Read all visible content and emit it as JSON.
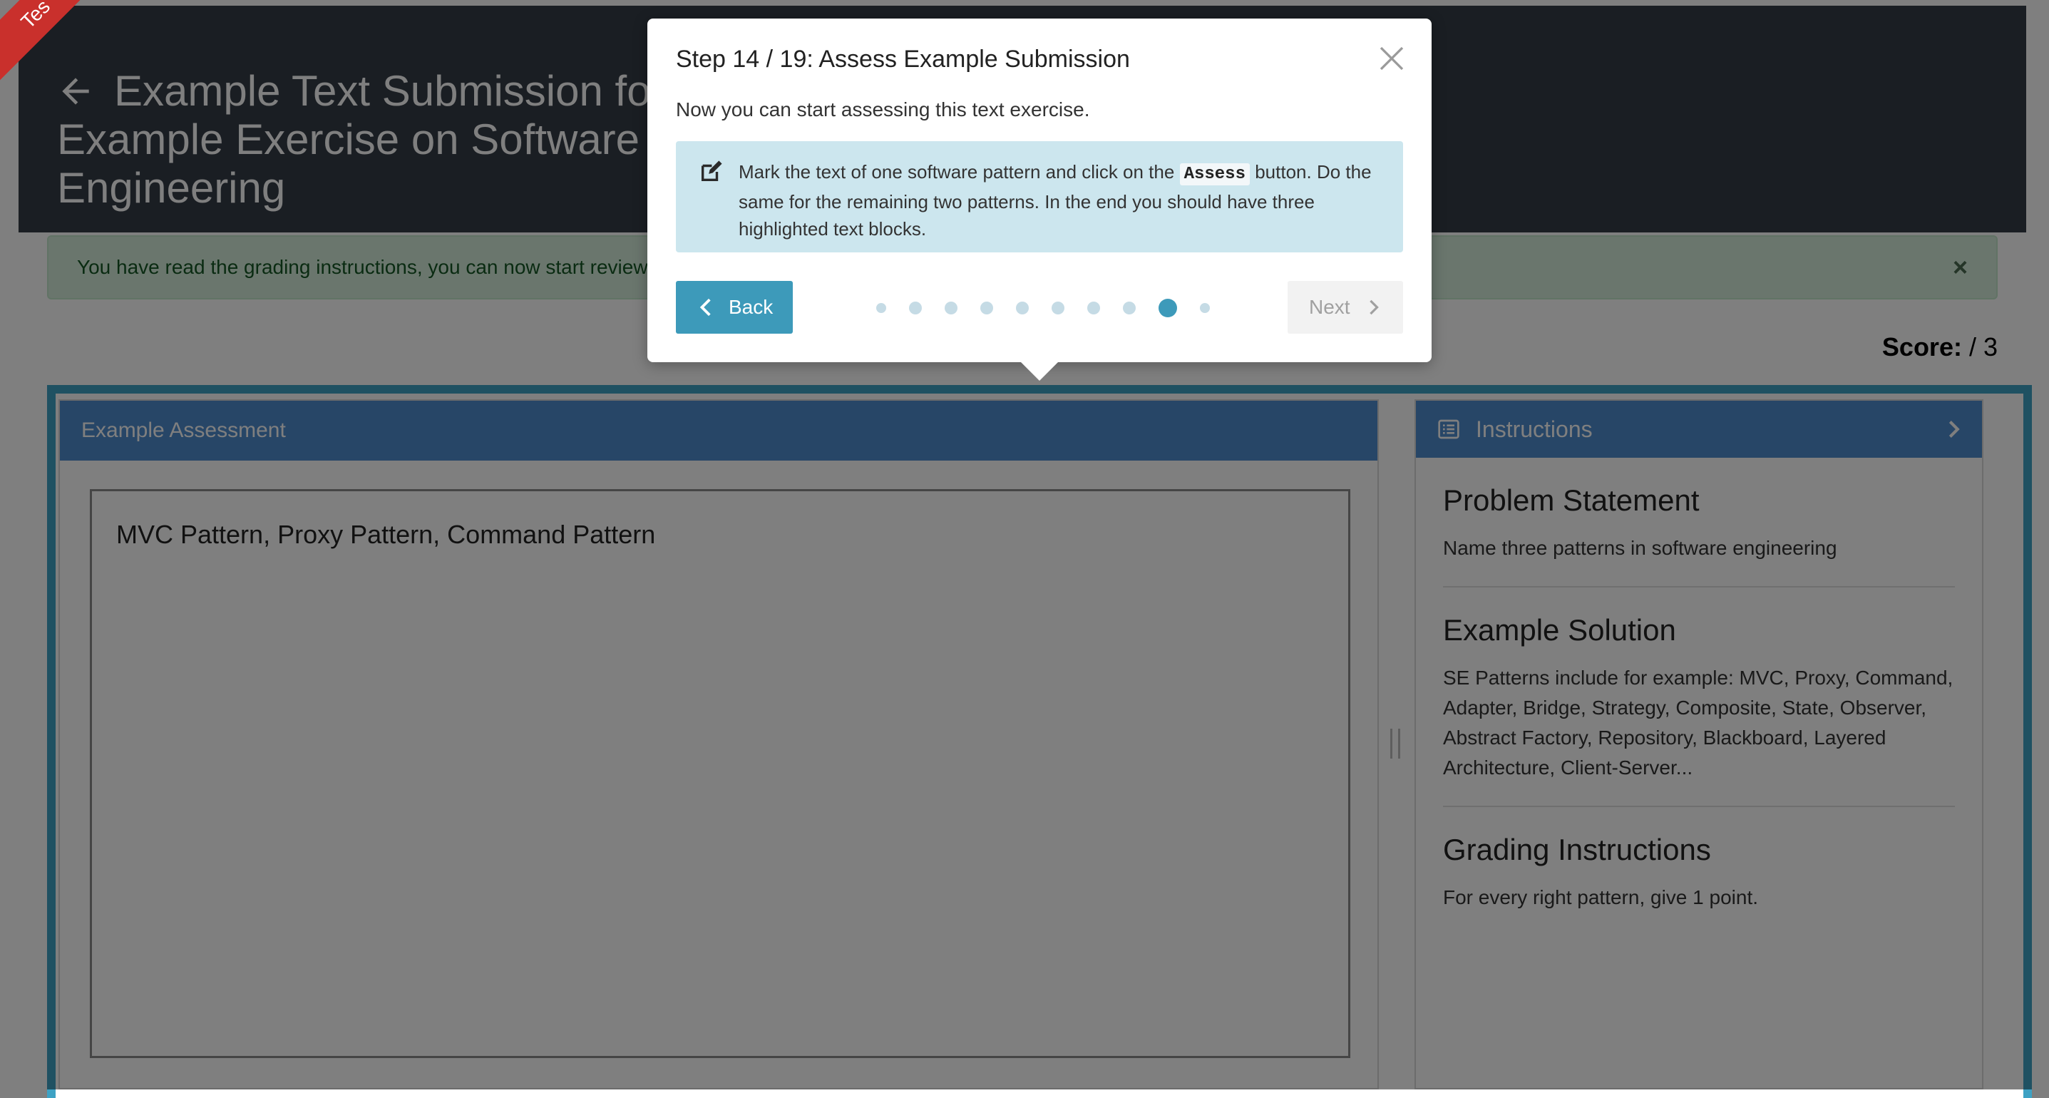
{
  "ribbon": {
    "label": "Tes"
  },
  "header": {
    "title": "Example Text Submission for Example Exercise on Software Engineering"
  },
  "alert": {
    "message": "You have read the grading instructions, you can now start reviewing the example submission.",
    "close_symbol": "×"
  },
  "score": {
    "label": "Score:",
    "value": "/ 3"
  },
  "assessment": {
    "header": "Example Assessment",
    "text": "MVC Pattern, Proxy Pattern, Command Pattern"
  },
  "instructions": {
    "header": "Instructions",
    "sections": [
      {
        "title": "Problem Statement",
        "body": "Name three patterns in software engineering"
      },
      {
        "title": "Example Solution",
        "body": "SE Patterns include for example: MVC, Proxy, Command, Adapter, Bridge, Strategy, Composite, State, Observer, Abstract Factory, Repository, Blackboard, Layered Architecture, Client-Server..."
      },
      {
        "title": "Grading Instructions",
        "body": "For every right pattern, give 1 point."
      }
    ]
  },
  "tour": {
    "title": "Step 14 / 19: Assess Example Submission",
    "subtitle": "Now you can start assessing this text exercise.",
    "info_before": "Mark the text of one software pattern and click on the ",
    "info_code": "Assess",
    "info_after": " button. Do the same for the remaining two patterns. In the end you should have three highlighted text blocks.",
    "back_label": "Back",
    "next_label": "Next",
    "dot_count": 10,
    "active_dot": 8
  },
  "colors": {
    "header_bg": "#353d47",
    "card_header": "#4f8ccf",
    "accent": "#3d9aba",
    "alert_bg": "#d4edda",
    "info_bg": "#cce6ee"
  }
}
